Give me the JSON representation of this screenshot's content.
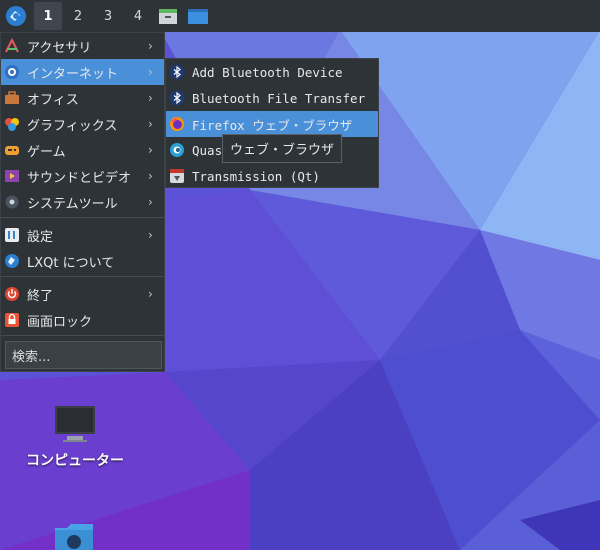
{
  "taskbar": {
    "desktops": [
      "1",
      "2",
      "3",
      "4"
    ],
    "active_desktop": "1"
  },
  "menu": {
    "items": [
      {
        "label": "アクセサリ",
        "icon": "accessories-icon",
        "has_submenu": true
      },
      {
        "label": "インターネット",
        "icon": "internet-icon",
        "has_submenu": true,
        "highlighted": true
      },
      {
        "label": "オフィス",
        "icon": "office-icon",
        "has_submenu": true
      },
      {
        "label": "グラフィックス",
        "icon": "graphics-icon",
        "has_submenu": true
      },
      {
        "label": "ゲーム",
        "icon": "games-icon",
        "has_submenu": true
      },
      {
        "label": "サウンドとビデオ",
        "icon": "multimedia-icon",
        "has_submenu": true
      },
      {
        "label": "システムツール",
        "icon": "system-tools-icon",
        "has_submenu": true
      },
      {
        "label": "設定",
        "icon": "settings-icon",
        "has_submenu": true
      },
      {
        "label": "LXQt について",
        "icon": "lxqt-logo-icon",
        "has_submenu": false
      },
      {
        "label": "終了",
        "icon": "power-icon",
        "has_submenu": true
      },
      {
        "label": "画面ロック",
        "icon": "lock-icon",
        "has_submenu": false
      }
    ],
    "search_placeholder": "検索..."
  },
  "submenu": {
    "items": [
      {
        "label": "Add Bluetooth Device",
        "icon": "bluetooth-icon"
      },
      {
        "label": "Bluetooth File Transfer",
        "icon": "bluetooth-icon"
      },
      {
        "label": "Firefox ウェブ・ブラウザ",
        "icon": "firefox-icon",
        "highlighted": true
      },
      {
        "label": "Quass",
        "icon": "quassel-icon"
      },
      {
        "label": "Transmission (Qt)",
        "icon": "transmission-icon"
      }
    ]
  },
  "tooltip": {
    "text": "ウェブ・ブラウザ"
  },
  "desktop": {
    "icons": [
      {
        "label": "コンピューター",
        "icon": "computer-icon"
      },
      {
        "label": "",
        "icon": "network-folder-icon"
      }
    ]
  },
  "colors": {
    "panel_bg": "#2e3338",
    "highlight": "#4a90d9",
    "wallpaper_base": "#5a4fd6"
  }
}
